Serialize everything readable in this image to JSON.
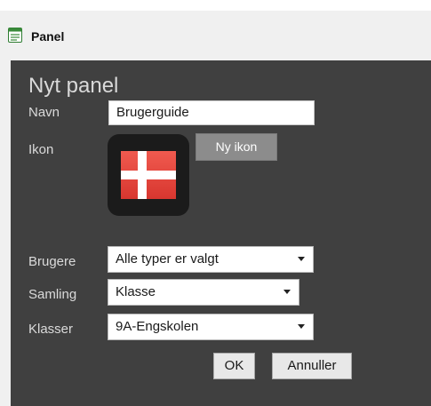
{
  "window": {
    "title": "Panel",
    "icon": "panel-icon"
  },
  "form": {
    "heading": "Nyt panel",
    "name_label": "Navn",
    "name_value": "Brugerguide",
    "icon_label": "Ikon",
    "icon_image": "danish-flag-icon",
    "new_icon_button": "Ny ikon",
    "users_label": "Brugere",
    "users_value": "Alle typer er valgt",
    "collection_label": "Samling",
    "collection_value": "Klasse",
    "classes_label": "Klasser",
    "classes_value": "9A-Engskolen",
    "ok_button": "OK",
    "cancel_button": "Annuller"
  },
  "colors": {
    "panel_background": "#404040",
    "flag_red": "#e8423b",
    "flag_white": "#ffffff",
    "accent_green": "#3a8a3a"
  }
}
